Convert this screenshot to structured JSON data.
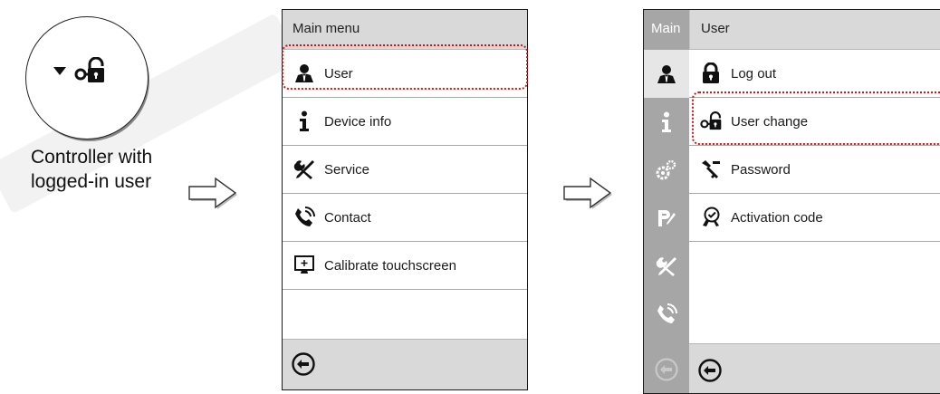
{
  "step1": {
    "caption_line1": "Controller with",
    "caption_line2": "logged-in user"
  },
  "main_menu": {
    "title": "Main menu",
    "items": [
      {
        "label": "User",
        "icon": "user-icon"
      },
      {
        "label": "Device info",
        "icon": "info-icon"
      },
      {
        "label": "Service",
        "icon": "tools-icon"
      },
      {
        "label": "Contact",
        "icon": "phone-icon"
      },
      {
        "label": "Calibrate touchscreen",
        "icon": "touchscreen-icon"
      }
    ],
    "highlighted": "User"
  },
  "user_menu": {
    "rail_title": "Main",
    "title": "User",
    "items": [
      {
        "label": "Log out",
        "icon": "lock-icon"
      },
      {
        "label": "User change",
        "icon": "user-change-icon"
      },
      {
        "label": "Password",
        "icon": "password-key-icon"
      },
      {
        "label": "Activation code",
        "icon": "activation-code-icon"
      }
    ],
    "highlighted": "User change"
  },
  "colors": {
    "highlight": "#d11111",
    "header_bg": "#d9d9d9",
    "rail_bg": "#a6a6a6"
  }
}
